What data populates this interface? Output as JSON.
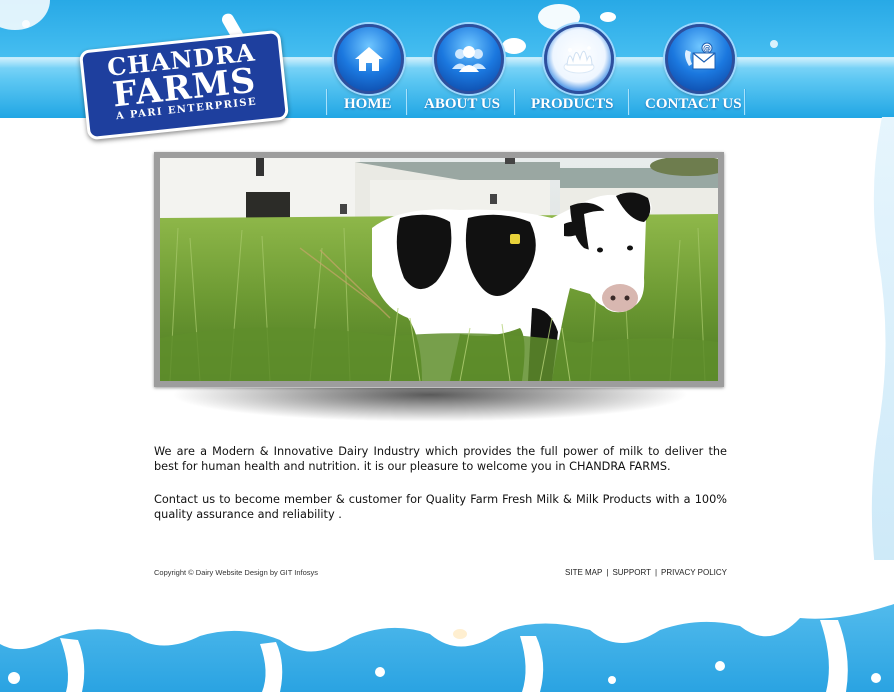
{
  "logo": {
    "line1": "CHANDRA",
    "line2": "FARMS",
    "tagline": "A PARI ENTERPRISE"
  },
  "nav": {
    "items": [
      {
        "label": "HOME",
        "icon": "home-icon"
      },
      {
        "label": "ABOUT US",
        "icon": "people-icon"
      },
      {
        "label": "PRODUCTS",
        "icon": "milk-splash-icon"
      },
      {
        "label": "CONTACT US",
        "icon": "email-phone-icon"
      }
    ]
  },
  "hero": {
    "image": "cow-in-field-photo"
  },
  "content": {
    "intro": "We are a Modern & Innovative Dairy Industry which provides the full power of milk to deliver the best for human health and nutrition. it is our pleasure to welcome you in CHANDRA FARMS.",
    "contact": "Contact us to become member & customer for Quality Farm Fresh Milk & Milk Products with a 100% quality assurance and reliability ."
  },
  "footer": {
    "copyright": "Copyright © Dairy Website Design by GIT Infosys",
    "links": {
      "site_map": "SITE MAP",
      "support": "SUPPORT",
      "privacy": "PRIVACY POLICY",
      "separator": "|"
    }
  },
  "colors": {
    "sky_blue": "#28a9e6",
    "nav_blue": "#5ec8f3",
    "logo_blue": "#1e3f9e",
    "text": "#111111"
  }
}
